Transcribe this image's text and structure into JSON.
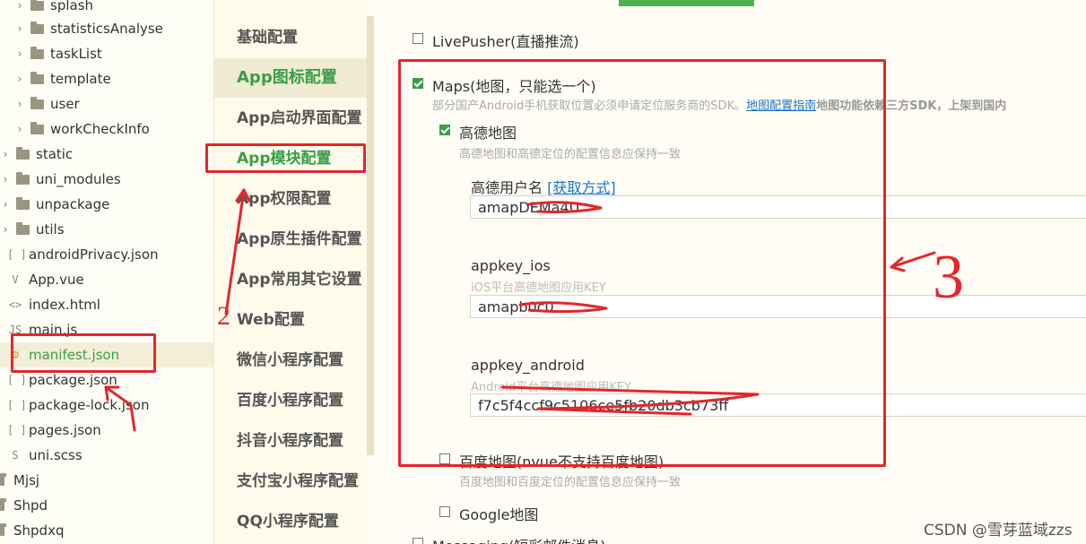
{
  "file_tree": {
    "items": [
      {
        "label": "splash",
        "type": "folder",
        "chevron": "›"
      },
      {
        "label": "statisticsAnalyse",
        "type": "folder",
        "chevron": "›"
      },
      {
        "label": "taskList",
        "type": "folder",
        "chevron": "›"
      },
      {
        "label": "template",
        "type": "folder",
        "chevron": "›"
      },
      {
        "label": "user",
        "type": "folder",
        "chevron": "›"
      },
      {
        "label": "workCheckInfo",
        "type": "folder",
        "chevron": "›"
      },
      {
        "label": "static",
        "type": "folder",
        "chevron": "›"
      },
      {
        "label": "uni_modules",
        "type": "folder",
        "chevron": "›"
      },
      {
        "label": "unpackage",
        "type": "folder",
        "chevron": "›"
      },
      {
        "label": "utils",
        "type": "folder",
        "chevron": "›"
      },
      {
        "label": "androidPrivacy.json",
        "type": "file",
        "icon": "[ ]"
      },
      {
        "label": "App.vue",
        "type": "file",
        "icon": "V"
      },
      {
        "label": "index.html",
        "type": "file",
        "icon": "<>"
      },
      {
        "label": "main.js",
        "type": "file",
        "icon": "JS"
      },
      {
        "label": "manifest.json",
        "type": "file",
        "icon": "⚙"
      },
      {
        "label": "package.json",
        "type": "file",
        "icon": "[ ]"
      },
      {
        "label": "package-lock.json",
        "type": "file",
        "icon": "[ ]"
      },
      {
        "label": "pages.json",
        "type": "file",
        "icon": "[ ]"
      },
      {
        "label": "uni.scss",
        "type": "file",
        "icon": "S"
      },
      {
        "label": "Mjsj",
        "type": "project"
      },
      {
        "label": "Shpd",
        "type": "project"
      },
      {
        "label": "Shpdxq",
        "type": "project"
      }
    ]
  },
  "settings_nav": {
    "items": [
      {
        "label": "基础配置"
      },
      {
        "label": "App图标配置"
      },
      {
        "label": "App启动界面配置"
      },
      {
        "label": "App模块配置"
      },
      {
        "label": "App权限配置"
      },
      {
        "label": "App原生插件配置"
      },
      {
        "label": "App常用其它设置"
      },
      {
        "label": "Web配置"
      },
      {
        "label": "微信小程序配置"
      },
      {
        "label": "百度小程序配置"
      },
      {
        "label": "抖音小程序配置"
      },
      {
        "label": "支付宝小程序配置"
      },
      {
        "label": "QQ小程序配置"
      }
    ]
  },
  "modules": {
    "livepusher": {
      "label": "LivePusher(直播推流)",
      "checked": false
    },
    "maps": {
      "label": "Maps(地图，只能选一个)",
      "checked": true,
      "hint": "部分国产Android手机获取位置必须申请定位服务商的SDK。",
      "hint_link": "地图配置指南",
      "hint_extra": "地图功能依赖三方SDK，上架到国内"
    },
    "amap": {
      "label": "高德地图",
      "checked": true,
      "hint": "高德地图和高德定位的配置信息应保持一致",
      "username_label": "高德用户名",
      "username_link": "[获取方式]",
      "username_value": "amapDEMa4U",
      "appkey_ios_label": "appkey_ios",
      "appkey_ios_hint": "iOS平台高德地图应用KEY",
      "appkey_ios_value": "amapb0c0",
      "appkey_android_label": "appkey_android",
      "appkey_android_hint": "Android平台高德地图应用KEY",
      "appkey_android_value": "f7c5f4ccf9c5106ce5fb20db3cb73ff"
    },
    "baidu": {
      "label": "百度地图(nvue不支持百度地图)",
      "checked": false,
      "hint": "百度地图和百度定位的配置信息应保持一致"
    },
    "google": {
      "label": "Google地图",
      "checked": false
    },
    "messaging": {
      "label": "Messaging(短彩邮件消息)",
      "checked": false
    }
  },
  "annotations": {
    "num2": "2",
    "num3": "3",
    "watermark": "CSDN @雪芽蓝域zzs",
    "red_color": "#e5262a"
  }
}
